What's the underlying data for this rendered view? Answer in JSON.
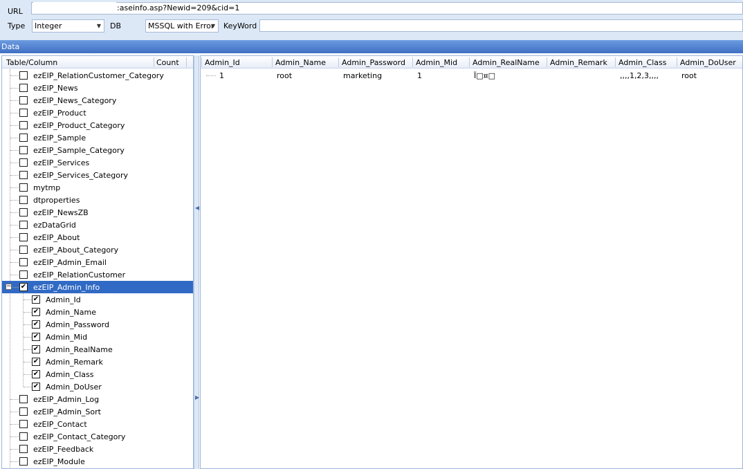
{
  "toolbar": {
    "url_label": "URL",
    "url_value": "':aseinfo.asp?Newid=209&cid=1",
    "type_label": "Type",
    "type_value": "Integer",
    "db_label": "DB",
    "db_value": "MSSQL with Error",
    "keyword_label": "KeyWord",
    "keyword_value": ""
  },
  "data_section": {
    "title": "Data"
  },
  "tree": {
    "header": {
      "table_column": "Table/Column",
      "count": "Count"
    },
    "top_items": [
      "ezEIP_RelationCustomer_Category",
      "ezEIP_News",
      "ezEIP_News_Category",
      "ezEIP_Product",
      "ezEIP_Product_Category",
      "ezEIP_Sample",
      "ezEIP_Sample_Category",
      "ezEIP_Services",
      "ezEIP_Services_Category",
      "mytmp",
      "dtproperties",
      "ezEIP_NewsZB",
      "ezDataGrid",
      "ezEIP_About",
      "ezEIP_About_Category",
      "ezEIP_Admin_Email",
      "ezEIP_RelationCustomer"
    ],
    "selected_item": "ezEIP_Admin_Info",
    "columns": [
      "Admin_Id",
      "Admin_Name",
      "Admin_Password",
      "Admin_Mid",
      "Admin_RealName",
      "Admin_Remark",
      "Admin_Class",
      "Admin_DoUser"
    ],
    "bottom_items": [
      "ezEIP_Admin_Log",
      "ezEIP_Admin_Sort",
      "ezEIP_Contact",
      "ezEIP_Contact_Category",
      "ezEIP_Feedback",
      "ezEIP_Module"
    ]
  },
  "grid": {
    "headers": [
      "Admin_Id",
      "Admin_Name",
      "Admin_Password",
      "Admin_Mid",
      "Admin_RealName",
      "Admin_Remark",
      "Admin_Class",
      "Admin_DoUser"
    ],
    "rows": [
      [
        "1",
        "root",
        "marketing",
        "1",
        "Ï□¤□",
        "",
        ",,,,1,2,3,,,,",
        "root"
      ]
    ]
  },
  "icons": {
    "checkbox_checked": "✔",
    "expander_minus": "−",
    "dropdown_arrow": "▼"
  },
  "colors": {
    "toolbar_bg": "#dde8f6",
    "data_bar": "#4a7bd0",
    "selection": "#316ac5"
  }
}
